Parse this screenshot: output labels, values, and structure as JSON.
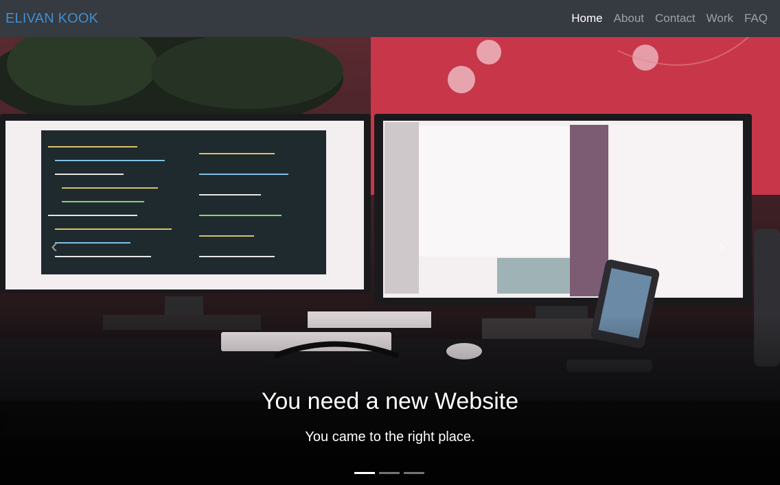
{
  "navbar": {
    "brand": "ELIVAN KOOK",
    "items": [
      {
        "label": "Home",
        "active": true
      },
      {
        "label": "About",
        "active": false
      },
      {
        "label": "Contact",
        "active": false
      },
      {
        "label": "Work",
        "active": false
      },
      {
        "label": "FAQ",
        "active": false
      }
    ]
  },
  "carousel": {
    "heading": "You need a new Website",
    "subheading": "You came to the right place.",
    "prev_icon": "chevron-left-icon",
    "next_icon": "chevron-right-icon",
    "slide_count": 3,
    "active_slide": 1
  },
  "colors": {
    "navbar_bg": "#363a41",
    "brand": "#3f8fd2",
    "nav_link": "#9da2a8",
    "nav_active": "#ffffff"
  }
}
